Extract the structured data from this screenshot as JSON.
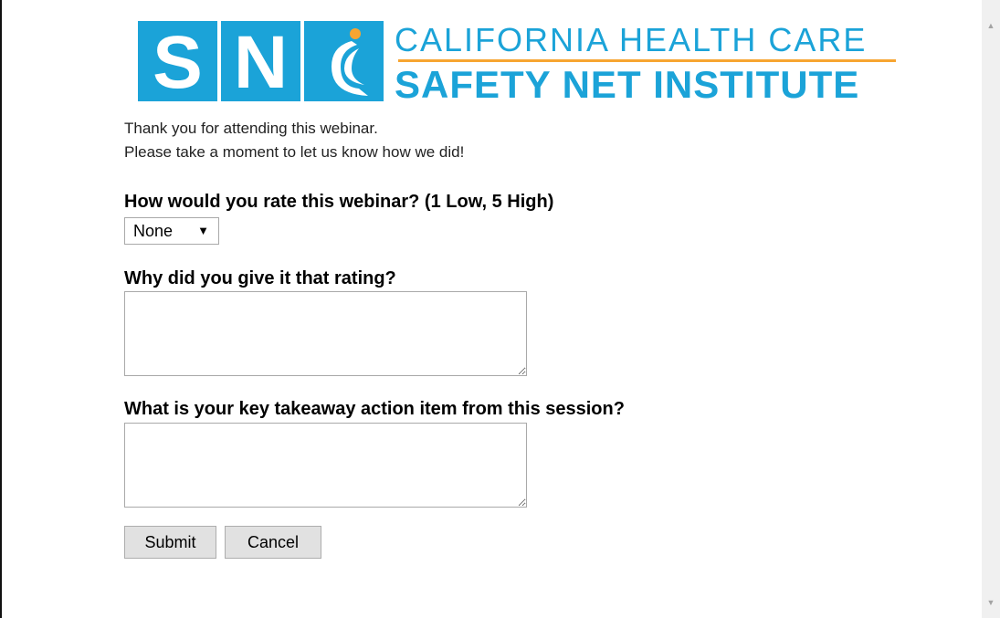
{
  "logo": {
    "letters": [
      "S",
      "N"
    ],
    "line1": "CALIFORNIA HEALTH CARE",
    "line2": "SAFETY NET INSTITUTE",
    "brand_blue": "#1ba3d8",
    "accent_orange": "#f7a531"
  },
  "intro": {
    "line1": "Thank you for attending this webinar.",
    "line2": "Please take a moment to let us know how we did!"
  },
  "questions": {
    "rating_label": "How would you rate this webinar? (1 Low, 5 High)",
    "rating_selected": "None",
    "why_label": "Why did you give it that rating?",
    "why_value": "",
    "takeaway_label": "What is your key takeaway action item from this session?",
    "takeaway_value": ""
  },
  "buttons": {
    "submit": "Submit",
    "cancel": "Cancel"
  },
  "scrollbar": {
    "up_icon": "chevron-up-icon",
    "down_icon": "chevron-down-icon"
  }
}
